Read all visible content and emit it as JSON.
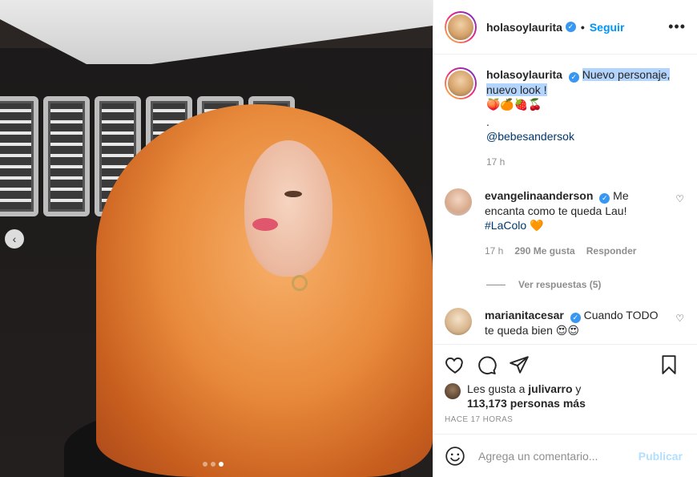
{
  "post": {
    "author": "holasoylaurita",
    "follow_label": "Seguir",
    "more_label": "•••",
    "caption": {
      "user": "holasoylaurita",
      "text_line1": "Nuevo personaje,",
      "text_line2": "nuevo look !",
      "emojis": "🍑🍊🍓🍒",
      "dot": ".",
      "mention": "@bebesandersok",
      "time": "17 h"
    },
    "comments": [
      {
        "user": "evangelinaanderson",
        "text_1": "Me",
        "text_2": "encanta como te queda Lau!",
        "hashtag": "#LaColo",
        "emoji": "🧡",
        "time": "17 h",
        "likes": "290 Me gusta",
        "reply_label": "Responder",
        "view_replies": "Ver respuestas (5)"
      },
      {
        "user": "marianitacesar",
        "text_1": "Cuando TODO",
        "text_2": "te queda bien",
        "emoji": "😍😍"
      }
    ],
    "likes": {
      "prefix": "Les gusta a",
      "user": "julivarro",
      "connector": "y",
      "count": "113,173 personas más"
    },
    "posted_ago": "HACE 17 HORAS",
    "add_comment": {
      "placeholder": "Agrega un comentario...",
      "publish_label": "Publicar"
    }
  },
  "carousel": {
    "current": 3,
    "total": 3
  },
  "colors": {
    "accent": "#0095f6",
    "verified": "#3897f0",
    "publish_disabled": "#b2dffc"
  }
}
